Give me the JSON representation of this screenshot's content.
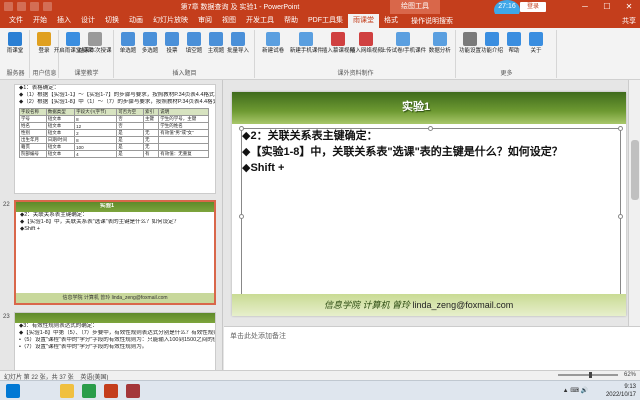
{
  "window": {
    "title": "第7章 数据查询 及 实验1 - PowerPoint",
    "context_tab": "绘图工具",
    "clock_badge": "27:16",
    "login_label": "登录",
    "controls": [
      "─",
      "☐",
      "✕"
    ]
  },
  "ribbon_tabs": [
    "文件",
    "开始",
    "插入",
    "设计",
    "切换",
    "动画",
    "幻灯片放映",
    "审阅",
    "视图",
    "开发工具",
    "帮助",
    "PDF工具集",
    "雨课堂",
    "格式"
  ],
  "active_tab": "雨课堂",
  "tell_me": "操作说明搜索",
  "share_label": "共享",
  "ribbon_groups": [
    {
      "label": "服务器",
      "buttons": [
        "雨课堂"
      ]
    },
    {
      "label": "用户信息",
      "buttons": [
        "登录"
      ]
    },
    {
      "label": "课堂教学",
      "buttons": [
        "开启雨课堂授课",
        "结束本次授课"
      ]
    },
    {
      "label": "插入题目",
      "buttons": [
        "单选题",
        "多选题",
        "投票",
        "填空题",
        "主观题",
        "批量导入"
      ]
    },
    {
      "label": "课外资料制作",
      "buttons": [
        "新建试卷",
        "新建手机课件",
        "插入慕课视频",
        "插入网络视频",
        "上传试卷/手机课件",
        "数据分析"
      ]
    },
    {
      "label": "更多",
      "buttons": [
        "功能设置",
        "功能介绍",
        "帮助",
        "关于"
      ]
    }
  ],
  "thumbnails": {
    "t1": {
      "lines": [
        "◆1：表格确定：",
        "◆（1）根据【实验1-1】～【实验1-7】的步骤与要求，按照教材P.34页表4.4格式，定义课程表结构。",
        "◆（2）根据【实验1-8】中（1）～（7）的步骤与要求，按照教材P.34页表4.4格式，定义学生表结构。"
      ],
      "table_header": [
        "字段名称",
        "数据类型",
        "字段大小(字节)",
        "可否为空",
        "索引",
        "说明"
      ],
      "table_rows": [
        [
          "学号",
          "短文本",
          "8",
          "否",
          "主键",
          "学生的学号，主键"
        ],
        [
          "姓名",
          "短文本",
          "12",
          "否",
          "",
          "学生的姓名"
        ],
        [
          "性别",
          "短文本",
          "2",
          "是",
          "无",
          "有效值\"男\"或\"女\""
        ],
        [
          "出生年月",
          "日期/时间",
          "8",
          "是",
          "无",
          ""
        ],
        [
          "籍贯",
          "短文本",
          "100",
          "是",
          "无",
          ""
        ],
        [
          "院部编号",
          "短文本",
          "4",
          "是",
          "有",
          "有效值：无重复"
        ]
      ]
    },
    "t2": {
      "number": "22",
      "title": "实验1",
      "lines": [
        "◆2：关联关系表主键确定：",
        "◆【实验1-8】中，关联关系表\"选课\"表的主键是什么？如何设定？",
        "◆Shift +"
      ],
      "footer": "信息学院 计算机 曾玲 linda_zeng@foxmail.com"
    },
    "t3": {
      "number": "23",
      "lines": [
        "◆3：有效性规则表达式的确定：",
        "◆【实验1-8】中第（5）、（7）步要中，有效性规则表达式分别是什么？有效性规则文本分别是什么？",
        "•（5）设置\"课程\"表中的\"学分\"字段的有效性规则为：只能输入100到1500之间的值。",
        "•（7）设置\"课程\"表中的\"学分\"字段的有效性规则为。"
      ]
    }
  },
  "slide": {
    "title": "实验1",
    "lines": [
      "◆2：关联关系表主键确定：",
      "◆【实验1-8】中，关联关系表\"选课\"表的主键是什么？如何设定？",
      "◆Shift +"
    ],
    "footer_prefix": "信息学院 计算机 曾玲",
    "footer_email": "linda_zeng@foxmail.com"
  },
  "notes_placeholder": "单击此处添加备注",
  "status": {
    "slide_info": "幻灯片 第 22 张，共 37 张",
    "language": "英语(美国)",
    "zoom": "62%",
    "zoom_fraction": 0.55
  },
  "taskbar": {
    "time": "9:13",
    "date": "2022/10/17",
    "apps": [
      "file-explorer",
      "browser",
      "powerpoint",
      "access"
    ]
  },
  "colors": {
    "accent": "#c43e1c",
    "ribbon_bg": "#f3f3f3",
    "slide_green": "#6e9a32"
  }
}
